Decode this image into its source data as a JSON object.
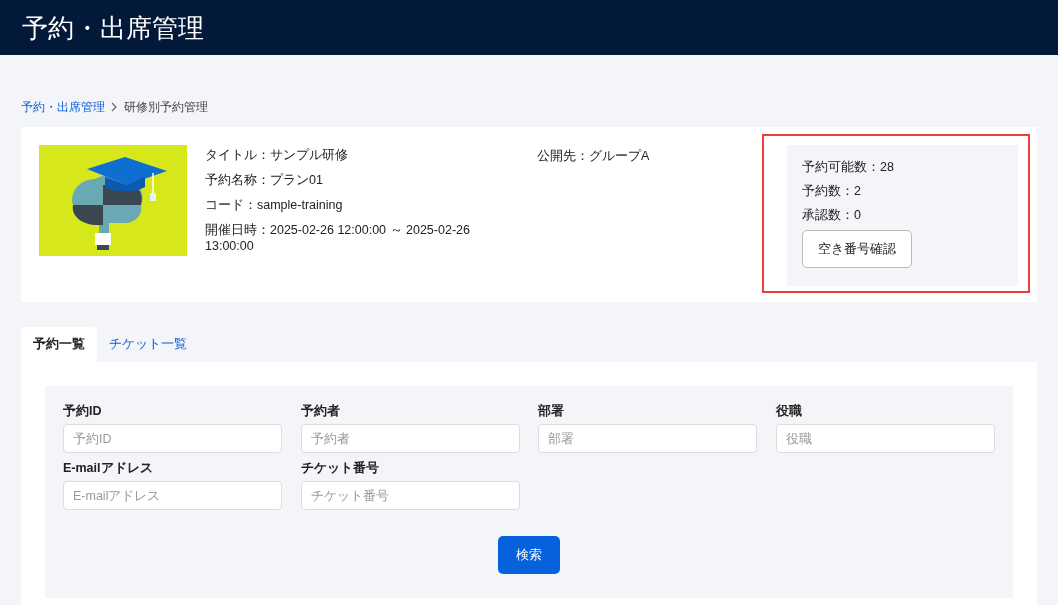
{
  "header": {
    "title": "予約・出席管理"
  },
  "breadcrumb": [
    {
      "label": "予約・出席管理",
      "kind": "link"
    },
    {
      "label": "研修別予約管理",
      "kind": "current"
    }
  ],
  "training": {
    "details": [
      "タイトル：サンプル研修",
      "予約名称：プラン01",
      "コード：sample-training",
      "開催日時：2025-02-26 12:00:00 ～ 2025-02-26 13:00:00"
    ],
    "audience": "公開先：グループA",
    "counts": [
      "予約可能数：28",
      "予約数：2",
      "承認数：0"
    ],
    "check_button": "空き番号確認"
  },
  "tabs": [
    {
      "label": "予約一覧",
      "selected": true
    },
    {
      "label": "チケット一覧",
      "selected": false
    }
  ],
  "search_form": {
    "fields": [
      {
        "label": "予約ID",
        "placeholder": "予約ID"
      },
      {
        "label": "予約者",
        "placeholder": "予約者"
      },
      {
        "label": "部署",
        "placeholder": "部署"
      },
      {
        "label": "役職",
        "placeholder": "役職"
      },
      {
        "label": "E-mailアドレス",
        "placeholder": "E-mailアドレス"
      },
      {
        "label": "チケット番号",
        "placeholder": "チケット番号"
      }
    ],
    "submit": "検索"
  }
}
